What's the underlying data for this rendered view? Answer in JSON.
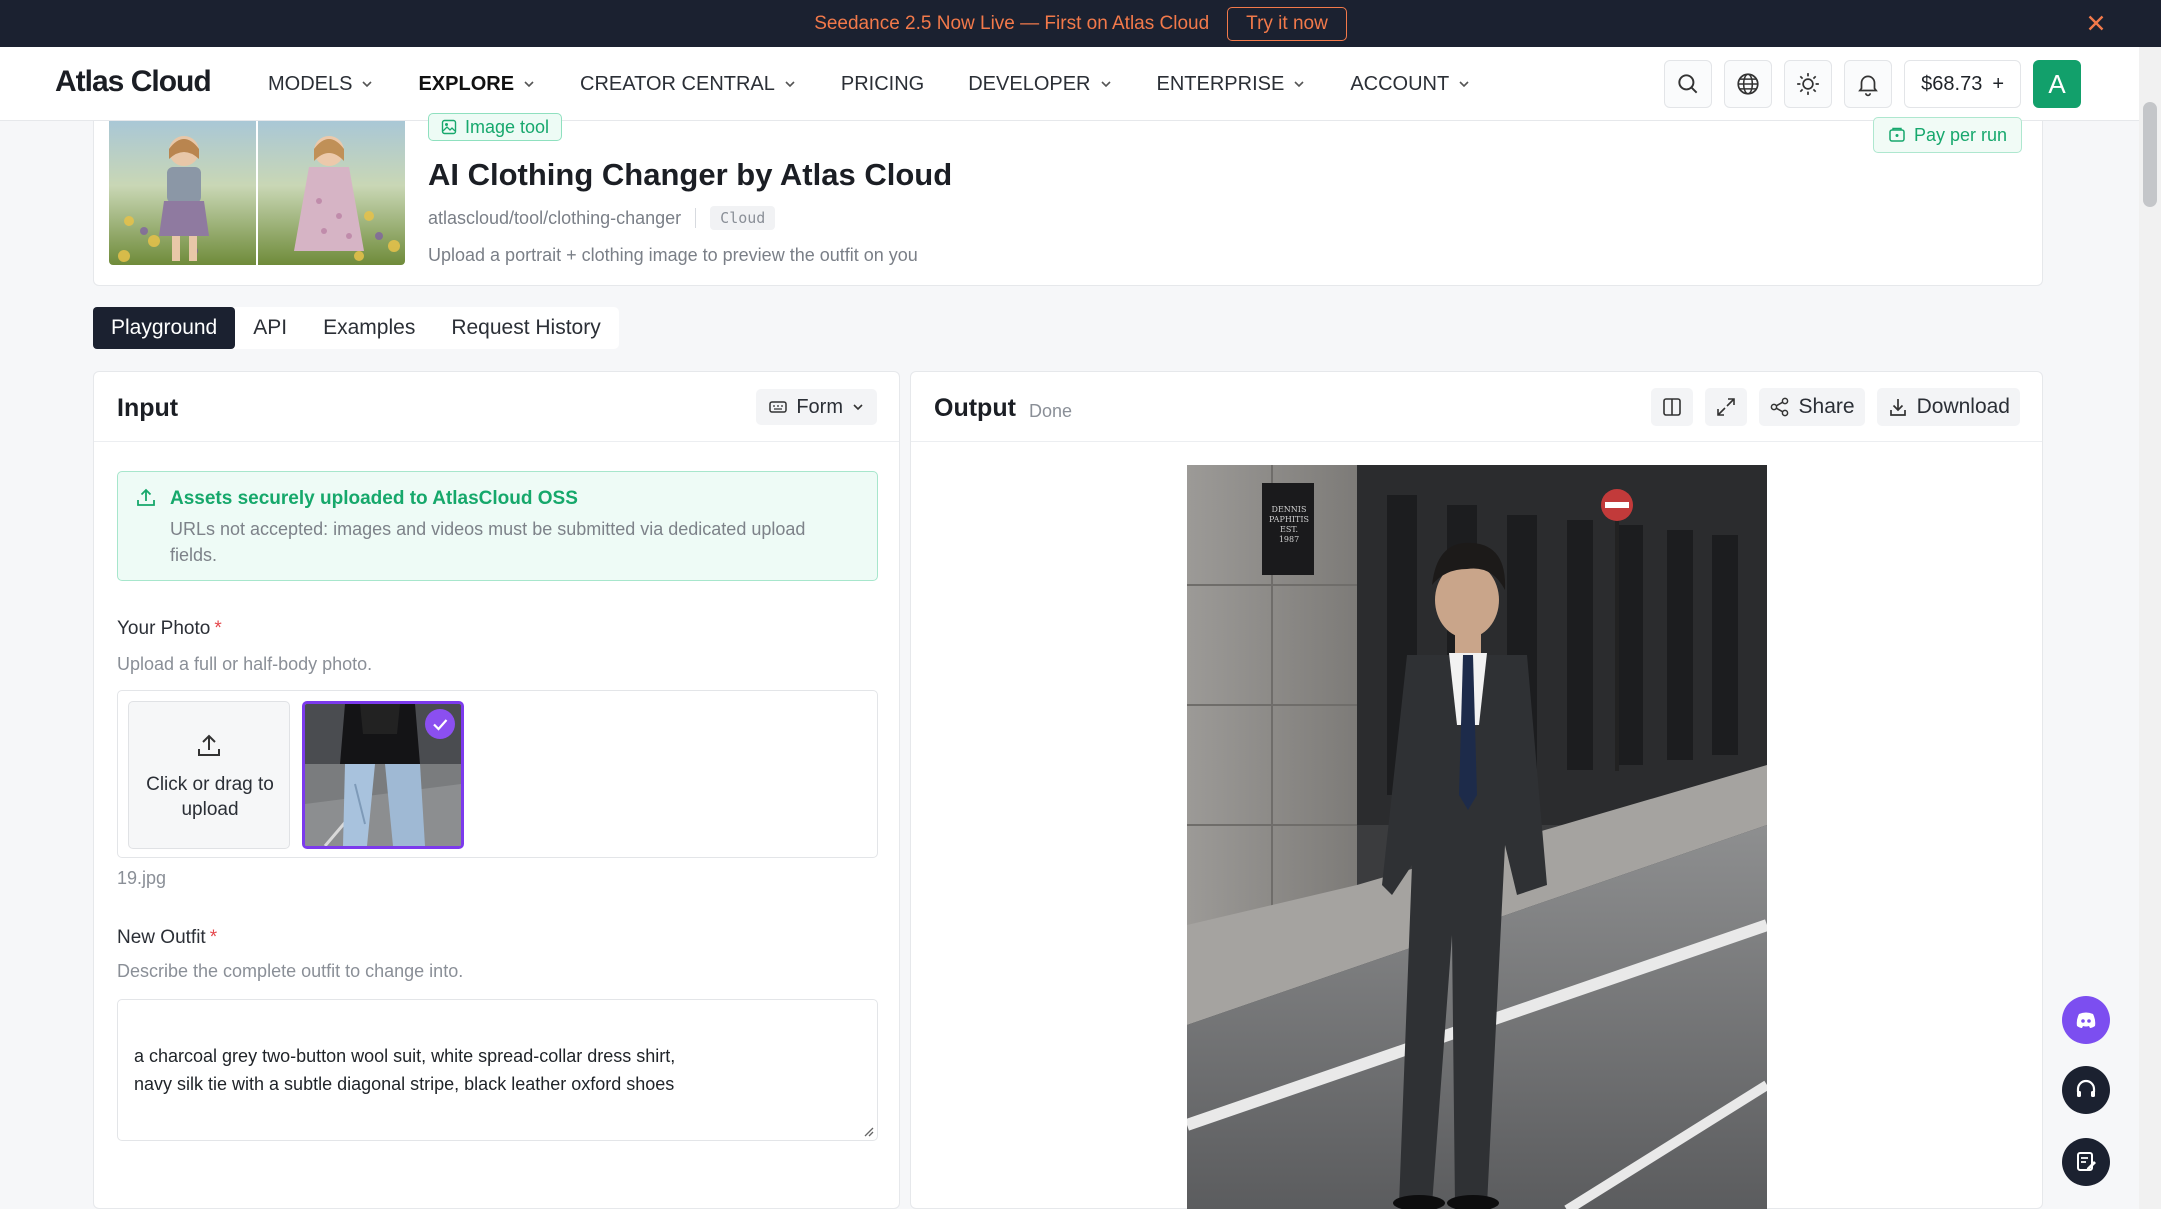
{
  "announcement": {
    "text": "Seedance 2.5 Now Live — First on Atlas Cloud",
    "cta": "Try it now"
  },
  "nav": {
    "logo": "Atlas Cloud",
    "items": [
      {
        "label": "MODELS"
      },
      {
        "label": "EXPLORE"
      },
      {
        "label": "CREATOR CENTRAL"
      },
      {
        "label": "PRICING"
      },
      {
        "label": "DEVELOPER"
      },
      {
        "label": "ENTERPRISE"
      },
      {
        "label": "ACCOUNT"
      }
    ],
    "balance": "$68.73",
    "balance_add": "+",
    "avatar_letter": "A"
  },
  "tool": {
    "badge": "Image tool",
    "title": "AI Clothing Changer by Atlas Cloud",
    "path": "atlascloud/tool/clothing-changer",
    "chip": "Cloud",
    "description": "Upload a portrait + clothing image to preview the outfit on you",
    "pricing": "Pay per run"
  },
  "tabs": [
    {
      "label": "Playground"
    },
    {
      "label": "API"
    },
    {
      "label": "Examples"
    },
    {
      "label": "Request History"
    }
  ],
  "input": {
    "title": "Input",
    "mode": "Form",
    "oss_title": "Assets securely uploaded to AtlasCloud OSS",
    "oss_sub": "URLs not accepted: images and videos must be submitted via dedicated upload fields.",
    "photo_label": "Your Photo",
    "photo_required": "*",
    "photo_hint": "Upload a full or half-body photo.",
    "upload_text": "Click or drag to upload",
    "file_name": "19.jpg",
    "outfit_label": "New Outfit",
    "outfit_required": "*",
    "outfit_hint": "Describe the complete outfit to change into.",
    "outfit_value": "a charcoal grey two-button wool suit, white spread-collar dress shirt,\nnavy silk tie with a subtle diagonal stripe, black leather oxford shoes"
  },
  "output": {
    "title": "Output",
    "status": "Done",
    "share": "Share",
    "download": "Download",
    "sign_text": "DENNIS PAPHITIS EST. 1987"
  },
  "colors": {
    "accent_green": "#16a86b",
    "announce_orange": "#f2794a",
    "selected_purple": "#7c3aed",
    "dark": "#1b2130"
  }
}
